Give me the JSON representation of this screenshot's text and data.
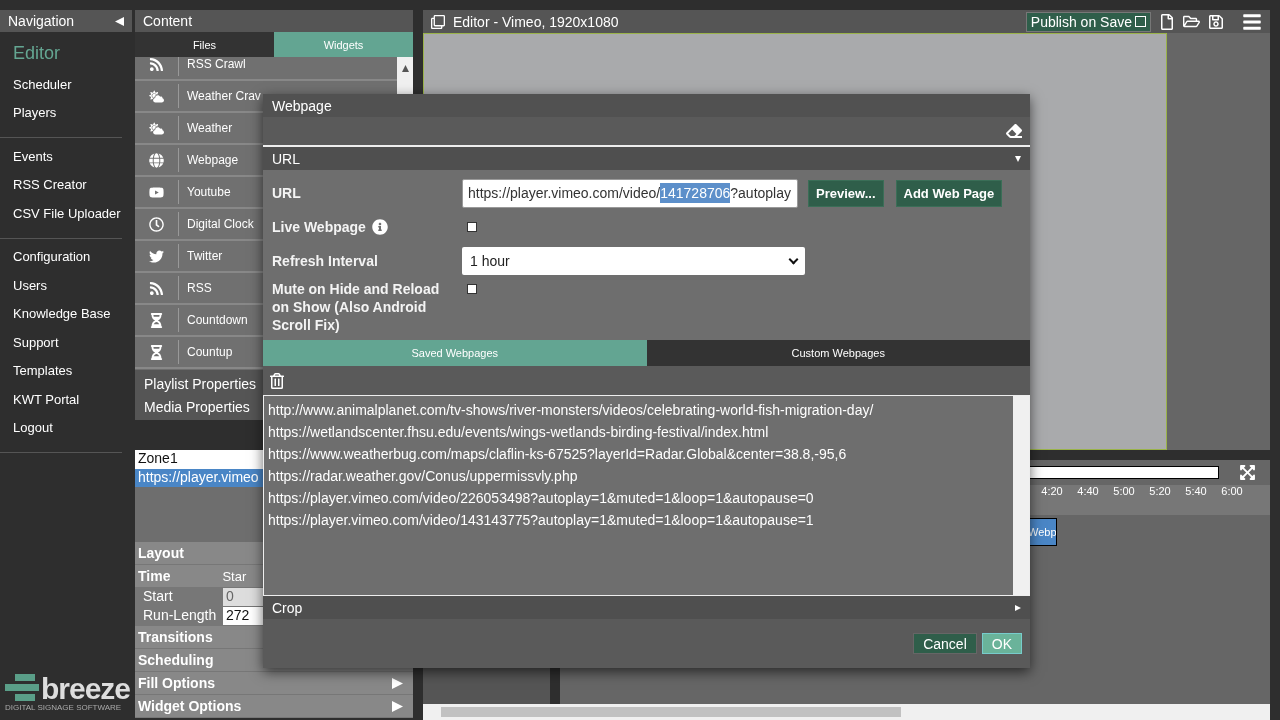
{
  "navigation": {
    "title": "Navigation",
    "groups": [
      [
        {
          "label": "Editor",
          "selected": true
        },
        {
          "label": "Scheduler",
          "selected": false
        },
        {
          "label": "Players",
          "selected": false
        }
      ],
      [
        {
          "label": "Events",
          "selected": false
        },
        {
          "label": "RSS Creator",
          "selected": false
        },
        {
          "label": "CSV File Uploader",
          "selected": false
        }
      ],
      [
        {
          "label": "Configuration",
          "selected": false
        },
        {
          "label": "Users",
          "selected": false
        },
        {
          "label": "Knowledge Base",
          "selected": false
        },
        {
          "label": "Support",
          "selected": false
        },
        {
          "label": "Templates",
          "selected": false
        },
        {
          "label": "KWT Portal",
          "selected": false
        },
        {
          "label": "Logout",
          "selected": false
        }
      ]
    ]
  },
  "logo": {
    "name": "breeze",
    "tagline": "DIGITAL SIGNAGE SOFTWARE"
  },
  "content": {
    "title": "Content",
    "tabs": [
      {
        "label": "Files",
        "selected": false
      },
      {
        "label": "Widgets",
        "selected": true
      }
    ],
    "widgets": [
      {
        "label": "RSS Crawl",
        "kind": "rss"
      },
      {
        "label": "Weather Crav",
        "kind": "weather"
      },
      {
        "label": "Weather",
        "kind": "weather"
      },
      {
        "label": "Webpage",
        "kind": "globe"
      },
      {
        "label": "Youtube",
        "kind": "play"
      },
      {
        "label": "Digital Clock",
        "kind": "clock"
      },
      {
        "label": "Twitter",
        "kind": "bird"
      },
      {
        "label": "RSS",
        "kind": "rss"
      },
      {
        "label": "Countdown",
        "kind": "hourglass"
      },
      {
        "label": "Countup",
        "kind": "hourglass"
      }
    ],
    "sections": [
      "Playlist Properties",
      "Media Properties"
    ],
    "zones": [
      {
        "label": "Zone1",
        "selected": false
      },
      {
        "label": "https://player.vimeo",
        "selected": true
      }
    ],
    "properties": [
      {
        "kind": "header",
        "label": "Layout"
      },
      {
        "kind": "header",
        "label": "Time",
        "note": "Star"
      },
      {
        "kind": "field",
        "label": "Start",
        "value": "0"
      },
      {
        "kind": "field",
        "label": "Run-Length",
        "value": "272"
      },
      {
        "kind": "header",
        "label": "Transitions"
      },
      {
        "kind": "header",
        "label": "Scheduling"
      },
      {
        "kind": "header",
        "label": "Fill Options",
        "expandable": true
      },
      {
        "kind": "header",
        "label": "Widget Options",
        "expandable": true
      }
    ]
  },
  "editor": {
    "title": "Editor - Vimeo, 1920x1080",
    "publish": {
      "label": "Publish on Save",
      "checked": false
    },
    "timeline": {
      "ticks": [
        "4:20",
        "4:40",
        "5:00",
        "5:20",
        "5:40",
        "6:00"
      ],
      "clip": "Webp"
    }
  },
  "dialog": {
    "title": "Webpage",
    "section": "URL",
    "url": {
      "label": "URL",
      "value": "https://player.vimeo.com/video/",
      "selection": "141728706",
      "value_end": "?autoplay"
    },
    "buttons": [
      "Preview...",
      "Add Web Page"
    ],
    "live": {
      "label": "Live Webpage",
      "checked": false
    },
    "refresh": {
      "label": "Refresh Interval",
      "value": "1 hour"
    },
    "mute": {
      "label": "Mute on Hide and Reload on Show (Also Android Scroll Fix)",
      "checked": false
    },
    "tabs": [
      {
        "label": "Saved Webpages",
        "selected": true
      },
      {
        "label": "Custom Webpages",
        "selected": false
      }
    ],
    "saved": [
      "http://www.animalplanet.com/tv-shows/river-monsters/videos/celebrating-world-fish-migration-day/",
      "https://wetlandscenter.fhsu.edu/events/wings-wetlands-birding-festival/index.html",
      "https://www.weatherbug.com/maps/claflin-ks-67525?layerId=Radar.Global&center=38.8,-95,6",
      "https://radar.weather.gov/Conus/uppermissvly.php",
      "https://player.vimeo.com/video/226053498?autoplay=1&muted=1&loop=1&autopause=0",
      "https://player.vimeo.com/video/143143775?autoplay=1&muted=1&loop=1&autopause=1"
    ],
    "crop": "Crop",
    "cancel": "Cancel",
    "ok": "OK"
  }
}
